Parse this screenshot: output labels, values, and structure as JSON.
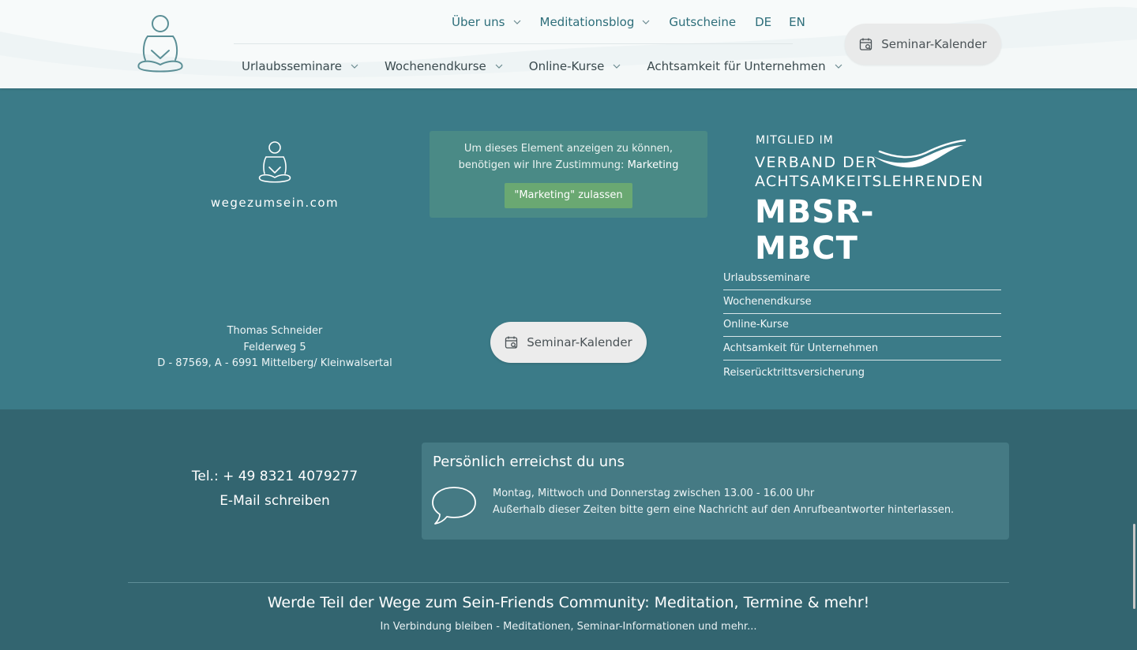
{
  "header": {
    "nav_top": [
      {
        "label": "Über uns",
        "has_dropdown": true
      },
      {
        "label": "Meditationsblog",
        "has_dropdown": true
      },
      {
        "label": "Gutscheine",
        "has_dropdown": false
      },
      {
        "label": "DE",
        "has_dropdown": false
      },
      {
        "label": "EN",
        "has_dropdown": false
      }
    ],
    "nav_bottom": [
      {
        "label": "Urlaubsseminare",
        "has_dropdown": true
      },
      {
        "label": "Wochenendkurse",
        "has_dropdown": true
      },
      {
        "label": "Online-Kurse",
        "has_dropdown": true
      },
      {
        "label": "Achtsamkeit für Unternehmen",
        "has_dropdown": true
      }
    ],
    "cta_label": "Seminar-Kalender",
    "cta_icon": "calendar-search-icon"
  },
  "footer": {
    "brand_name": "wegezumsein.com",
    "consent": {
      "text": "Um dieses Element anzeigen zu können, benötigen wir Ihre Zustimmung:",
      "category": "Marketing",
      "button_label": "\"Marketing\" zulassen"
    },
    "membership": {
      "line1": "MITGLIED IM",
      "line2": "VERBAND DER",
      "line3": "ACHTSAMKEITSLEHRENDEN",
      "line4": "MBSR-MBCT"
    },
    "address": {
      "name": "Thomas Schneider",
      "street": "Felderweg 5",
      "city": "D - 87569, A - 6991 Mittelberg/ Kleinwalsertal"
    },
    "cta_label": "Seminar-Kalender",
    "links": [
      "Urlaubsseminare",
      "Wochenendkurse",
      "Online-Kurse",
      "Achtsamkeit für Unternehmen",
      "Reiserücktrittsversicherung"
    ],
    "contact": {
      "tel": "Tel.: + 49 8321 4079277",
      "email_label": "E-Mail schreiben"
    },
    "reach": {
      "title": "Persönlich erreichst du uns",
      "line1": "Montag, Mittwoch und Donnerstag zwischen 13.00 - 16.00 Uhr",
      "line2": "Außerhalb dieser Zeiten bitte gern eine Nachricht auf den Anrufbeantworter hinterlassen.",
      "icon": "speech-bubble-icon"
    },
    "community_title": "Werde Teil der Wege zum Sein-Friends Community: Meditation, Termine & mehr!",
    "community_sub": "In Verbindung bleiben - Meditationen, Seminar-Informationen und mehr..."
  },
  "colors": {
    "footer_teal": "#3b7b88",
    "footer_dark": "#336570",
    "nav_accent": "#2d6e7a",
    "consent_button": "#6aa872"
  }
}
